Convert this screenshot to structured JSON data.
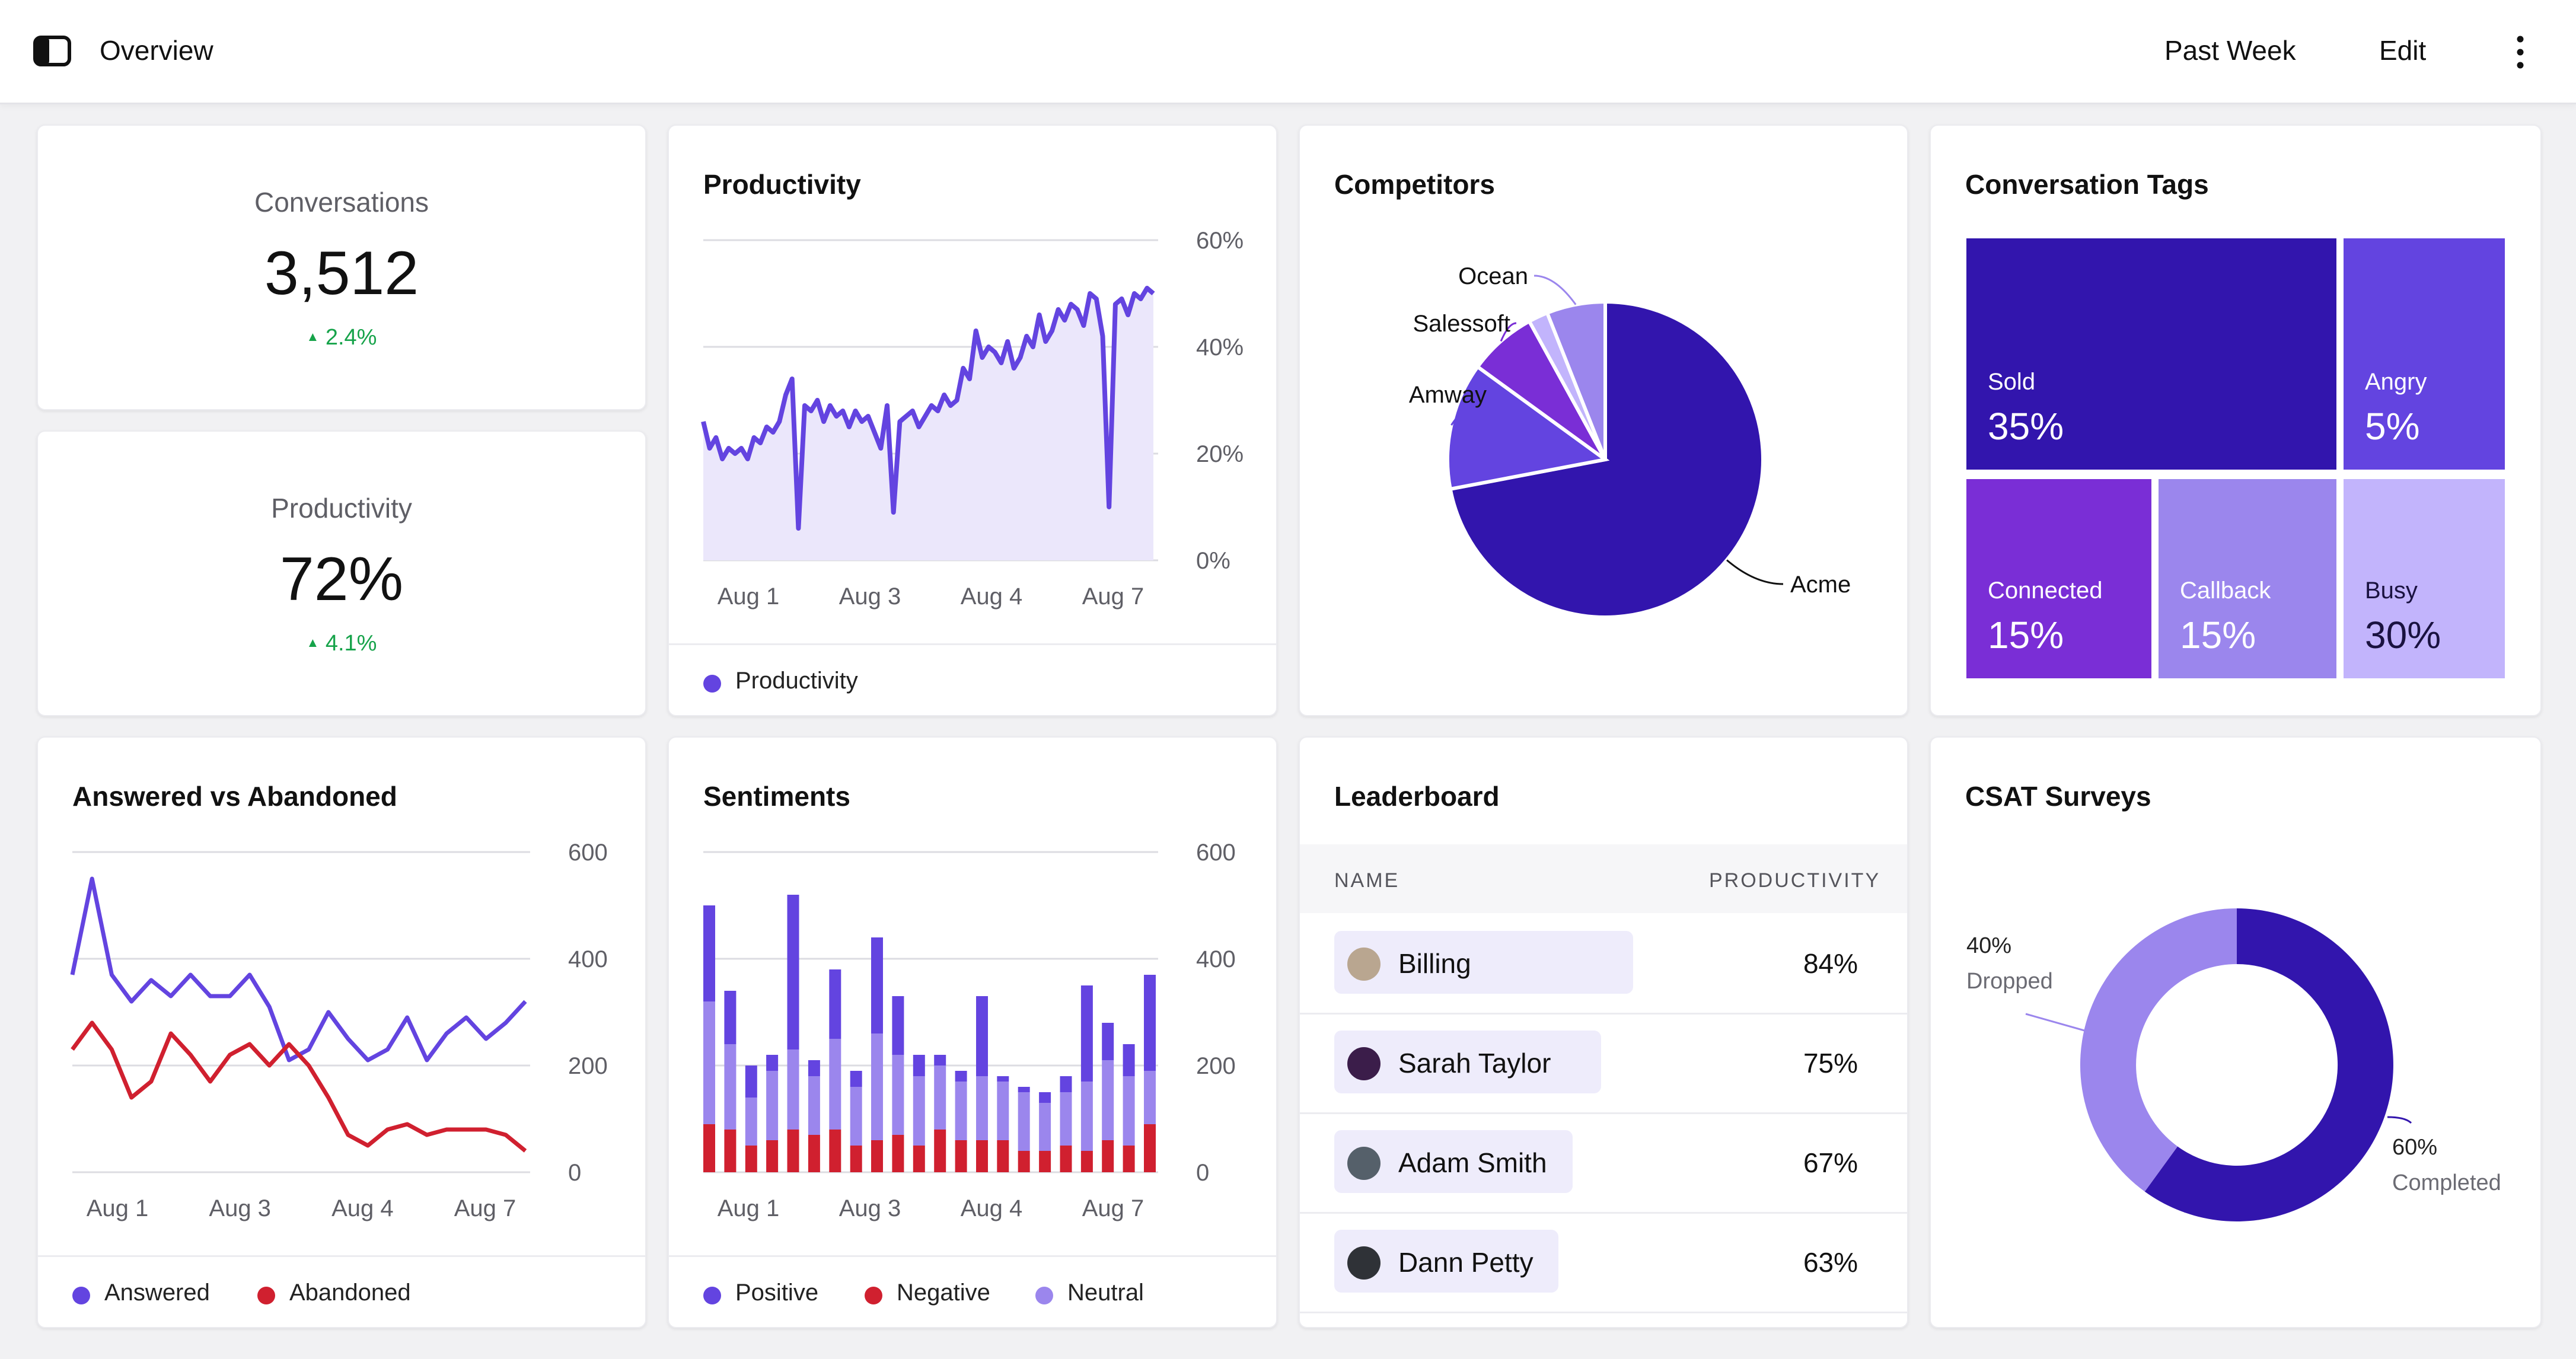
{
  "header": {
    "title": "Overview",
    "range_label": "Past Week",
    "edit_label": "Edit"
  },
  "kpis": {
    "conversations": {
      "label": "Conversations",
      "value": "3,512",
      "delta": "2.4%"
    },
    "productivity": {
      "label": "Productivity",
      "value": "72%",
      "delta": "4.1%"
    }
  },
  "colors": {
    "accent": "#6344e0",
    "accent_dark": "#3215ad",
    "accent_light": "#9b86ed",
    "accent_pale": "#c2b4fc",
    "area_fill": "#ebe7fb",
    "red": "#d0202f",
    "positive_delta": "#16a34a"
  },
  "productivity_card": {
    "title": "Productivity",
    "legend": [
      "Productivity"
    ]
  },
  "competitors_card": {
    "title": "Competitors"
  },
  "tags_card": {
    "title": "Conversation Tags",
    "tags": [
      {
        "label": "Sold",
        "value": "35%",
        "color": "#3215ad"
      },
      {
        "label": "Angry",
        "value": "5%",
        "color": "#6344e0"
      },
      {
        "label": "Connected",
        "value": "15%",
        "color": "#7a2ed6"
      },
      {
        "label": "Callback",
        "value": "15%",
        "color": "#9b86ed"
      },
      {
        "label": "Busy",
        "value": "30%",
        "color": "#c2b4fc"
      }
    ]
  },
  "answered_card": {
    "title": "Answered vs Abandoned",
    "legend": [
      "Answered",
      "Abandoned"
    ]
  },
  "sentiments_card": {
    "title": "Sentiments",
    "legend": [
      "Positive",
      "Negative",
      "Neutral"
    ]
  },
  "leaderboard": {
    "title": "Leaderboard",
    "col_name": "NAME",
    "col_productivity": "PRODUCTIVITY",
    "rows": [
      {
        "name": "Billing",
        "value": "84%",
        "fraction": 0.84
      },
      {
        "name": "Sarah Taylor",
        "value": "75%",
        "fraction": 0.75
      },
      {
        "name": "Adam Smith",
        "value": "67%",
        "fraction": 0.67
      },
      {
        "name": "Dann Petty",
        "value": "63%",
        "fraction": 0.63
      }
    ]
  },
  "csat_card": {
    "title": "CSAT Surveys"
  },
  "chart_data": [
    {
      "id": "productivity",
      "type": "area",
      "x_tick_labels": [
        "Aug 1",
        "Aug 3",
        "Aug 4",
        "Aug 7"
      ],
      "y_tick_labels": [
        "60%",
        "40%",
        "20%",
        "0%"
      ],
      "ylim": [
        0,
        60
      ],
      "grid": true,
      "series": [
        {
          "name": "Productivity",
          "color": "#6344e0",
          "values": [
            26,
            21,
            23,
            19,
            21,
            20,
            21,
            19,
            23,
            22,
            25,
            24,
            26,
            31,
            34,
            6,
            29,
            28,
            30,
            26,
            29,
            27,
            28,
            25,
            28,
            26,
            27,
            24,
            21,
            29,
            9,
            26,
            27,
            28,
            25,
            27,
            29,
            28,
            31,
            29,
            30,
            36,
            34,
            43,
            38,
            40,
            39,
            37,
            41,
            36,
            38,
            42,
            40,
            46,
            41,
            43,
            47,
            45,
            48,
            47,
            44,
            50,
            49,
            42,
            10,
            48,
            49,
            46,
            50,
            49,
            51,
            50
          ]
        }
      ]
    },
    {
      "id": "competitors",
      "type": "pie",
      "labels": [
        "Acme",
        "Amway",
        "Salessoft",
        "",
        "Ocean"
      ],
      "values": [
        72,
        13,
        7,
        2,
        6
      ],
      "colors": [
        "#3215ad",
        "#6344e0",
        "#7a2ed6",
        "#c2b4fc",
        "#9b86ed"
      ]
    },
    {
      "id": "answered_vs_abandoned",
      "type": "line",
      "x_tick_labels": [
        "Aug 1",
        "Aug 3",
        "Aug 4",
        "Aug 7"
      ],
      "y_tick_labels": [
        "600",
        "400",
        "200",
        "0"
      ],
      "ylim": [
        0,
        600
      ],
      "grid": true,
      "series": [
        {
          "name": "Answered",
          "color": "#6344e0",
          "values": [
            370,
            550,
            370,
            320,
            360,
            330,
            370,
            330,
            330,
            370,
            310,
            210,
            230,
            300,
            250,
            210,
            230,
            290,
            210,
            260,
            290,
            250,
            280,
            320
          ]
        },
        {
          "name": "Abandoned",
          "color": "#d0202f",
          "values": [
            230,
            280,
            230,
            140,
            170,
            260,
            220,
            170,
            220,
            240,
            200,
            240,
            200,
            140,
            70,
            50,
            80,
            90,
            70,
            80,
            80,
            80,
            70,
            40
          ]
        }
      ]
    },
    {
      "id": "sentiments",
      "type": "bar",
      "stacked": true,
      "x_tick_labels": [
        "Aug 1",
        "Aug 3",
        "Aug 4",
        "Aug 7"
      ],
      "y_tick_labels": [
        "600",
        "400",
        "200",
        "0"
      ],
      "ylim": [
        0,
        600
      ],
      "grid": true,
      "series": [
        {
          "name": "Neutral",
          "color": "#9b86ed",
          "values": [
            230,
            160,
            90,
            130,
            150,
            110,
            170,
            110,
            200,
            150,
            130,
            120,
            110,
            120,
            110,
            110,
            90,
            100,
            130,
            150,
            130,
            100
          ]
        },
        {
          "name": "Negative",
          "color": "#d0202f",
          "values": [
            90,
            80,
            50,
            60,
            80,
            70,
            80,
            50,
            60,
            70,
            50,
            80,
            60,
            60,
            60,
            40,
            40,
            50,
            40,
            60,
            50,
            90
          ]
        },
        {
          "name": "Positive",
          "color": "#6344e0",
          "values": [
            180,
            100,
            60,
            30,
            290,
            30,
            130,
            30,
            180,
            110,
            40,
            20,
            20,
            150,
            10,
            10,
            20,
            30,
            180,
            70,
            60,
            180
          ]
        }
      ]
    },
    {
      "id": "csat",
      "type": "pie",
      "donut": true,
      "labels": [
        "Completed",
        "Dropped"
      ],
      "values": [
        60,
        40
      ],
      "value_labels": [
        "60%",
        "40%"
      ],
      "colors": [
        "#3215ad",
        "#9b86ed"
      ]
    }
  ]
}
